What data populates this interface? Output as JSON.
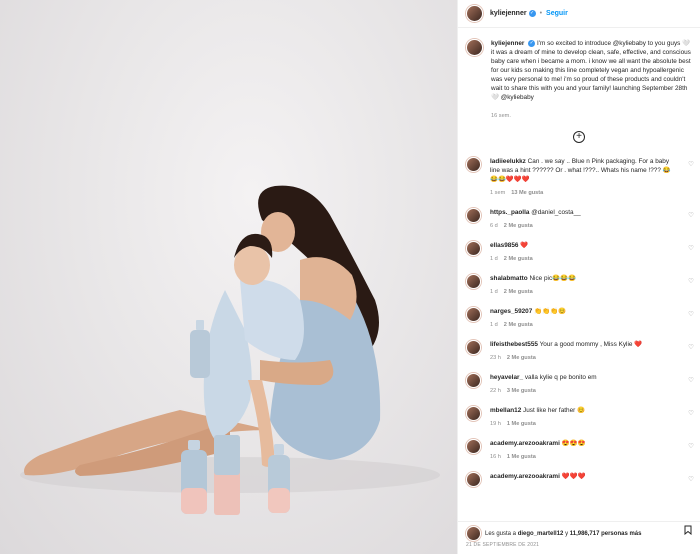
{
  "post": {
    "username": "kyliejenner",
    "follow_label": "Seguir",
    "caption": "I'm so excited to introduce @kyliebaby to you guys 🤍 it was a dream of mine to develop clean, safe, effective, and conscious baby care when i became a mom. i know we all want the absolute best for our kids so making this line completely vegan and hypoallergenic was very personal to me! i'm so proud of these products and couldn't wait to share this with you and your family! launching September 28th 🤍 @kyliebaby",
    "time_ago": "16 sem."
  },
  "comments": [
    {
      "user": "ladiieelukkz",
      "text": "Can . we say .. Blue n Pink packaging. For a baby line was a hint ?????? Or . what !???.. Whats his name !??? 😂😂😂❤️❤️❤️",
      "time": "1 sem",
      "likes": "13 Me gusta"
    },
    {
      "user": "https._paolla",
      "text": "@daniel_costa__",
      "time": "6 d",
      "likes": "2 Me gusta"
    },
    {
      "user": "ellas9856",
      "text": "❤️",
      "time": "1 d",
      "likes": "2 Me gusta"
    },
    {
      "user": "shalabmatto",
      "text": "Nice pic😂😂😂",
      "time": "1 d",
      "likes": "2 Me gusta"
    },
    {
      "user": "narges_59207",
      "text": "👏👏👏😊",
      "time": "1 d",
      "likes": "2 Me gusta"
    },
    {
      "user": "lifeisthebest555",
      "text": "Your a good mommy , Miss Kylie ❤️",
      "time": "23 h",
      "likes": "2 Me gusta"
    },
    {
      "user": "heyavelar_",
      "text": "valla kylie q pe bonito em",
      "time": "22 h",
      "likes": "3 Me gusta"
    },
    {
      "user": "mbellan12",
      "text": "Just like her father 😊",
      "time": "19 h",
      "likes": "1 Me gusta"
    },
    {
      "user": "academy.arezooakrami",
      "text": "😍😍😍",
      "time": "16 h",
      "likes": "1 Me gusta"
    },
    {
      "user": "academy.arezooakrami",
      "text": "❤️❤️❤️",
      "time": "",
      "likes": ""
    }
  ],
  "footer": {
    "liked_by_prefix": "Les gusta a",
    "liked_by_user": "diego_martell12",
    "liked_by_connector": "y",
    "liked_by_others": "11,986,717 personas más",
    "date": "21 DE SEPTIEMBRE DE 2021"
  },
  "colors": {
    "accent": "#0095f6",
    "verified": "#3897f0",
    "photo_bg": "#e6e4e5"
  }
}
